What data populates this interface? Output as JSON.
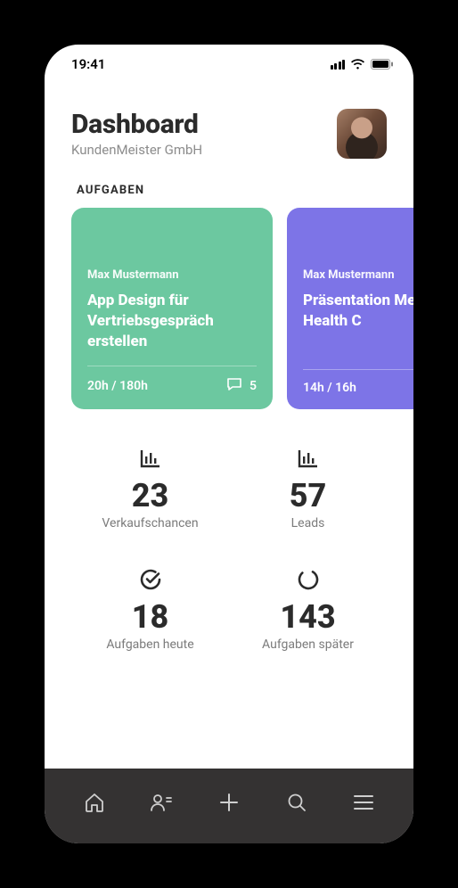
{
  "statusbar": {
    "time": "19:41"
  },
  "header": {
    "title": "Dashboard",
    "subtitle": "KundenMeister GmbH"
  },
  "tasks": {
    "section_label": "AUFGABEN",
    "cards": [
      {
        "assignee": "Max Mustermann",
        "title": "App Design für Vertriebsgespräch erstellen",
        "time": "20h / 180h",
        "comments": "5",
        "color": "green"
      },
      {
        "assignee": "Max Mustermann",
        "title": "Präsentation Medical Health C",
        "time": "14h / 16h",
        "comments": "",
        "color": "purple"
      }
    ]
  },
  "stats": [
    {
      "icon": "bar-chart-icon",
      "value": "23",
      "label": "Verkaufschancen"
    },
    {
      "icon": "bar-chart-icon",
      "value": "57",
      "label": "Leads"
    },
    {
      "icon": "check-circle-icon",
      "value": "18",
      "label": "Aufgaben heute"
    },
    {
      "icon": "progress-circle-icon",
      "value": "143",
      "label": "Aufgaben später"
    }
  ],
  "nav": {
    "items": [
      "home-icon",
      "user-add-icon",
      "plus-icon",
      "search-icon",
      "menu-icon"
    ]
  }
}
